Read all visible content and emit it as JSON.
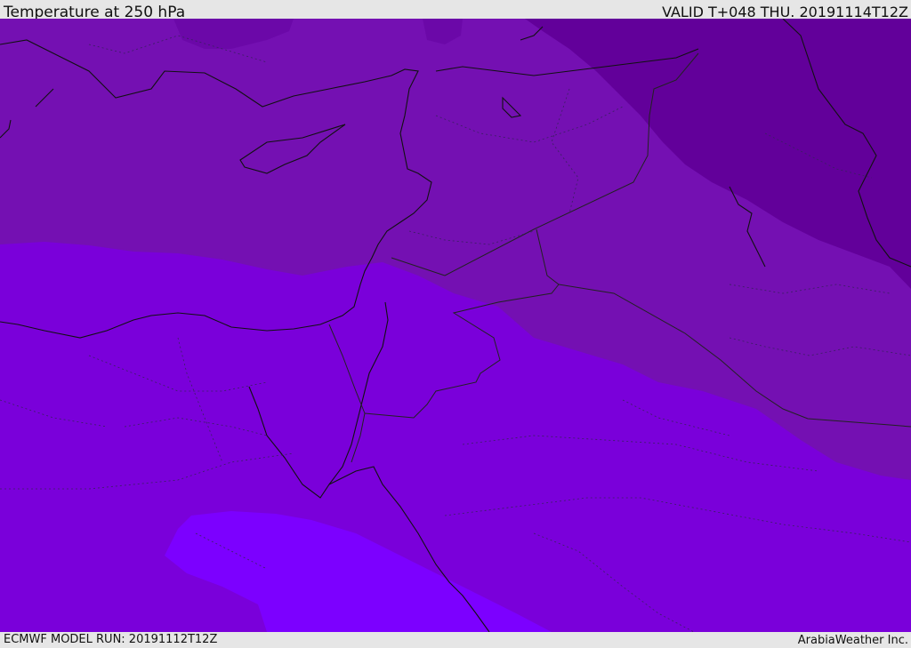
{
  "header": {
    "title": "Temperature at 250 hPa",
    "valid": "VALID T+048 THU. 20191114T12Z"
  },
  "footer": {
    "model_run": "ECMWF MODEL RUN: 20191112T12Z",
    "credit": "ArabiaWeather Inc."
  },
  "map": {
    "colors": {
      "band_coldest": "#62009a",
      "band_cold": "#7410b2",
      "band_mid": "#7a00da",
      "band_warm": "#7c00ff",
      "coastline": "#111111",
      "border": "#222222"
    }
  }
}
